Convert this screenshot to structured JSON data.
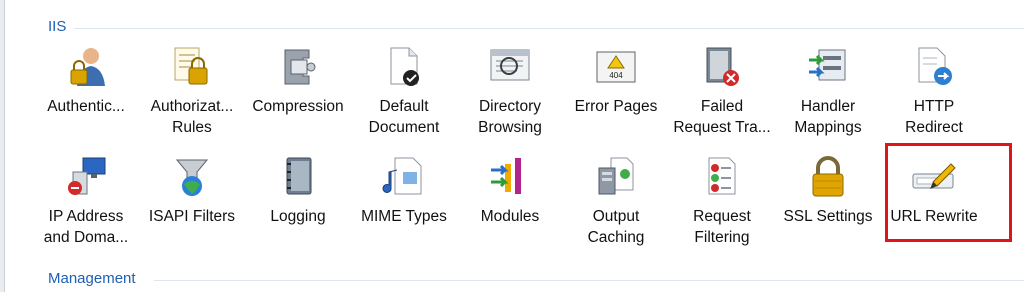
{
  "sections": {
    "iis": "IIS",
    "management": "Management"
  },
  "features": [
    {
      "label": "Authentic...",
      "icon": "user-lock-icon"
    },
    {
      "label": "Authorizat...\nRules",
      "icon": "authorization-rules-icon"
    },
    {
      "label": "Compression",
      "icon": "compression-clamp-icon"
    },
    {
      "label": "Default\nDocument",
      "icon": "default-document-icon"
    },
    {
      "label": "Directory\nBrowsing",
      "icon": "directory-browsing-icon"
    },
    {
      "label": "Error Pages",
      "icon": "error-404-icon"
    },
    {
      "label": "Failed\nRequest Tra...",
      "icon": "failed-request-tracing-icon"
    },
    {
      "label": "Handler\nMappings",
      "icon": "handler-mappings-icon"
    },
    {
      "label": "HTTP\nRedirect",
      "icon": "http-redirect-icon"
    },
    {
      "label": "IP Address\nand Doma...",
      "icon": "ip-restrictions-icon"
    },
    {
      "label": "ISAPI Filters",
      "icon": "isapi-filters-icon"
    },
    {
      "label": "Logging",
      "icon": "logging-notebook-icon"
    },
    {
      "label": "MIME Types",
      "icon": "mime-types-icon"
    },
    {
      "label": "Modules",
      "icon": "modules-icon"
    },
    {
      "label": "Output\nCaching",
      "icon": "output-caching-icon"
    },
    {
      "label": "Request\nFiltering",
      "icon": "request-filtering-icon"
    },
    {
      "label": "SSL Settings",
      "icon": "padlock-icon"
    },
    {
      "label": "URL Rewrite",
      "icon": "url-rewrite-icon"
    }
  ],
  "colors": {
    "section_header": "#1e5fb4",
    "highlight": "#e0141b"
  }
}
